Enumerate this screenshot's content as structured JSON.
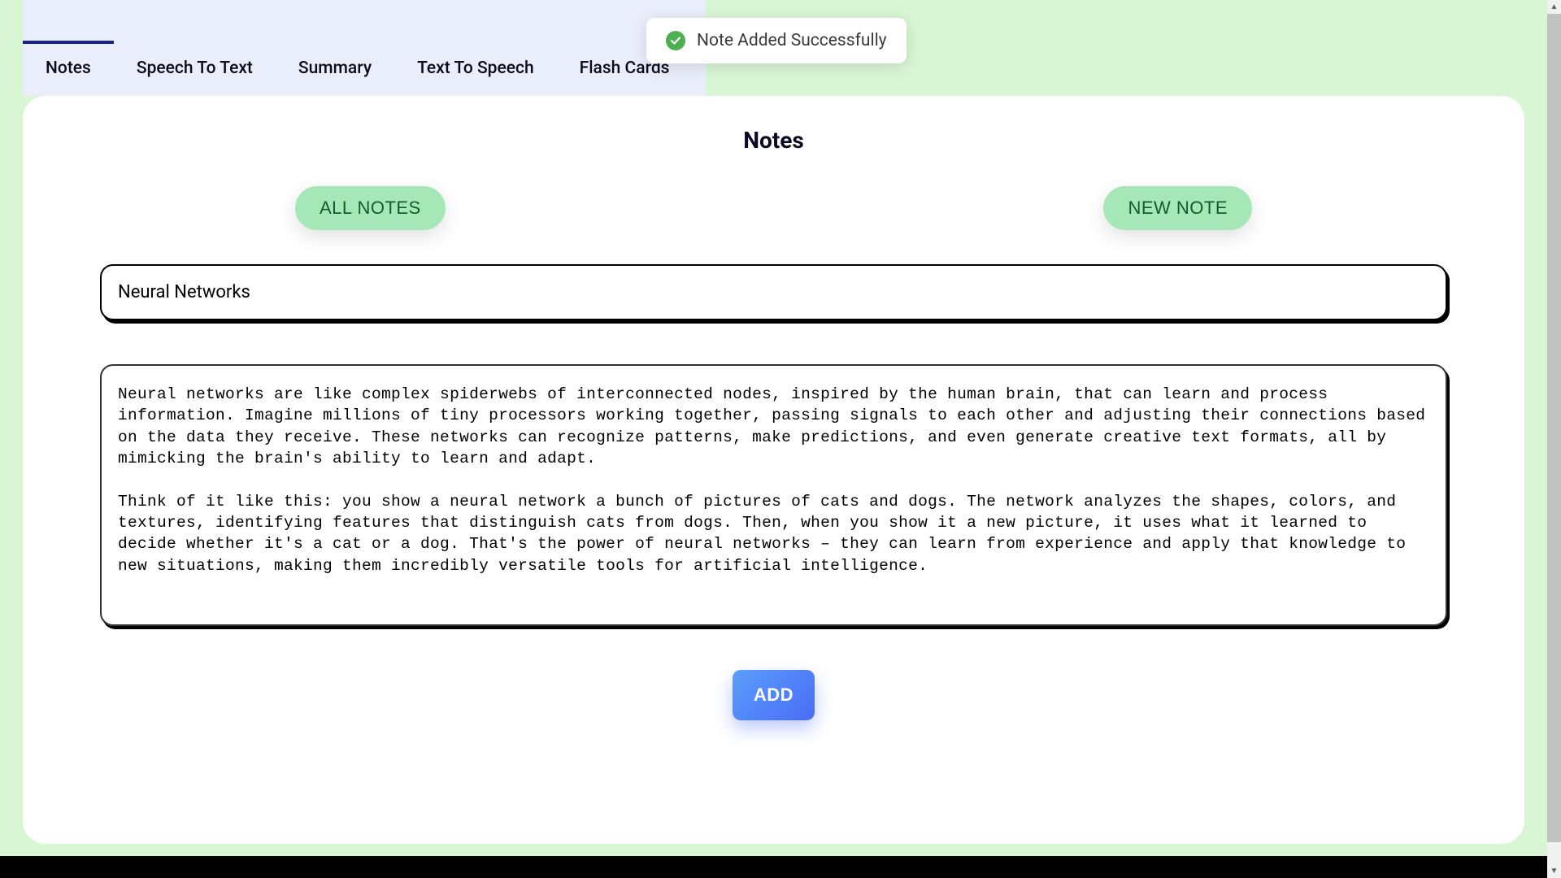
{
  "toast": {
    "message": "Note Added Successfully"
  },
  "tabs": [
    {
      "label": "Notes",
      "active": true
    },
    {
      "label": "Speech To Text",
      "active": false
    },
    {
      "label": "Summary",
      "active": false
    },
    {
      "label": "Text To Speech",
      "active": false
    },
    {
      "label": "Flash Cards",
      "active": false
    }
  ],
  "page": {
    "title": "Notes"
  },
  "buttons": {
    "all_notes": "ALL NOTES",
    "new_note": "NEW NOTE",
    "add": "ADD"
  },
  "note": {
    "title": "Neural Networks",
    "content": "Neural networks are like complex spiderwebs of interconnected nodes, inspired by the human brain, that can learn and process information. Imagine millions of tiny processors working together, passing signals to each other and adjusting their connections based on the data they receive. These networks can recognize patterns, make predictions, and even generate creative text formats, all by mimicking the brain's ability to learn and adapt.\n\nThink of it like this: you show a neural network a bunch of pictures of cats and dogs. The network analyzes the shapes, colors, and textures, identifying features that distinguish cats from dogs. Then, when you show it a new picture, it uses what it learned to decide whether it's a cat or a dog. That's the power of neural networks – they can learn from experience and apply that knowledge to new situations, making them incredibly versatile tools for artificial intelligence."
  }
}
